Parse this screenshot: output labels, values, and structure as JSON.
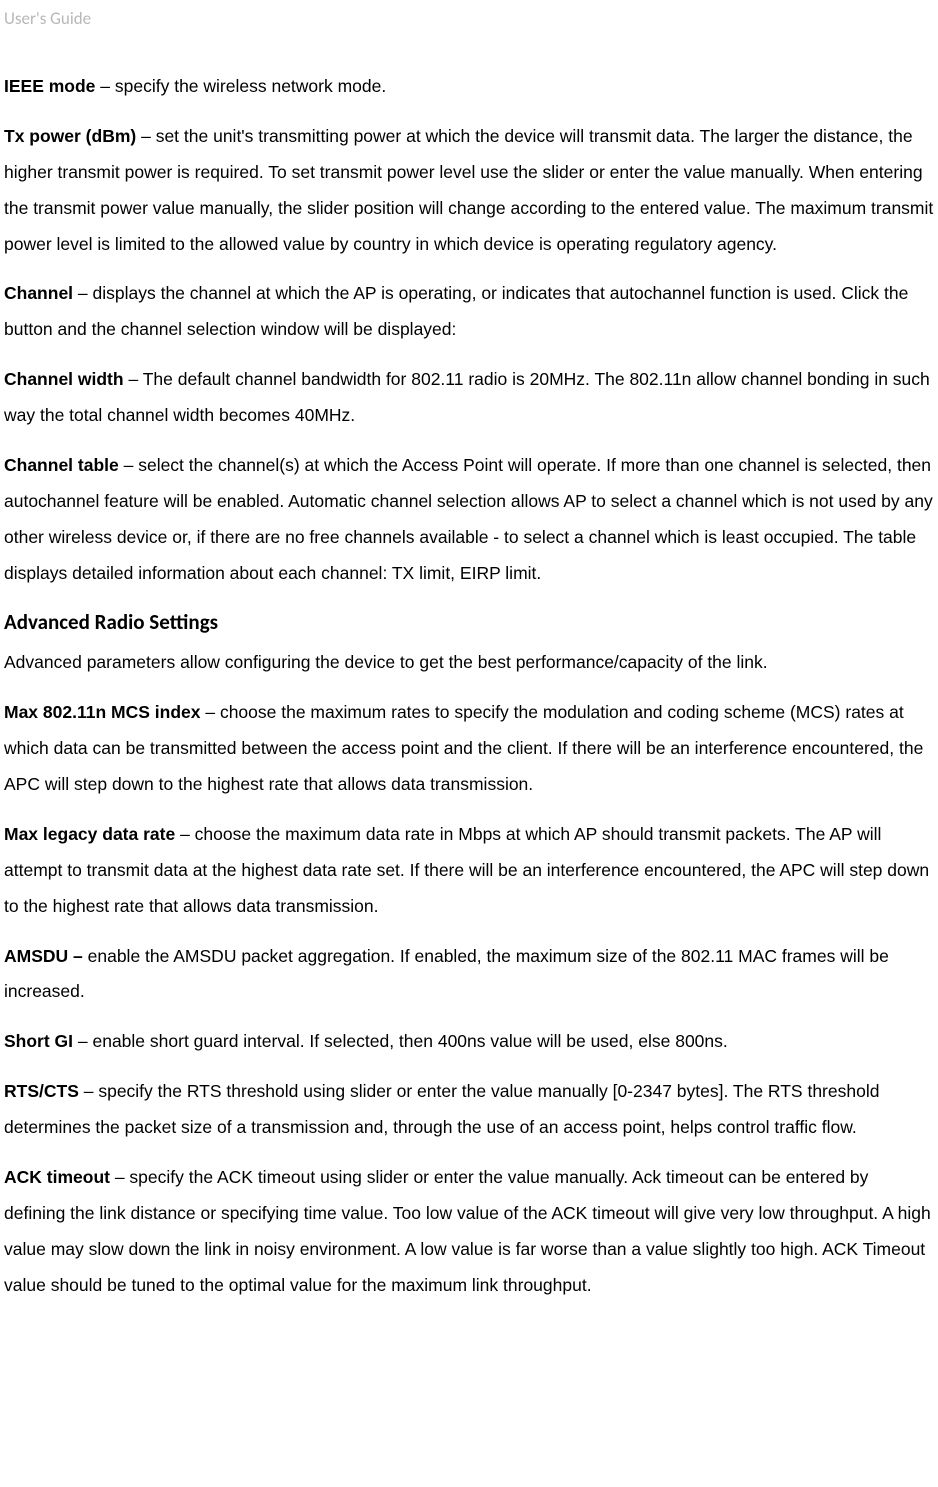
{
  "header": {
    "label": "User's Guide"
  },
  "paragraphs": {
    "ieee_mode": {
      "term": "IEEE mode",
      "text": " – specify the wireless network mode."
    },
    "tx_power": {
      "term": "Tx power (dBm)",
      "text": " – set the unit's transmitting power at which the device will transmit data. The larger the distance, the higher transmit power is required. To set transmit power level use the slider or enter the value manually. When entering the transmit power value manually, the slider position will change according to the entered value. The maximum transmit power level is limited to the allowed value by country in which device is operating regulatory agency."
    },
    "channel": {
      "term": "Channel",
      "text": " – displays the channel at which the AP is operating, or indicates that autochannel function is used. Click the button and the channel selection window will be displayed:"
    },
    "channel_width": {
      "term": "Channel width",
      "text": " – The default channel bandwidth for 802.11 radio is 20MHz. The 802.11n allow channel bonding in such way the total channel width becomes 40MHz."
    },
    "channel_table": {
      "term": "Channel table",
      "text": " – select the channel(s) at which the Access Point will operate. If more than one channel is selected, then autochannel feature will be enabled. Automatic channel selection allows AP to select a channel which is not used by any other wireless device or, if there are no free channels available - to select a channel which is least occupied. The table displays detailed information about each channel: TX limit, EIRP limit."
    },
    "advanced_heading": "Advanced Radio Settings",
    "advanced_intro": "Advanced parameters allow configuring the device to get the best performance/capacity of the link.",
    "max_mcs": {
      "term": "Max 802.11n MCS index",
      "text": " – choose the maximum rates to specify the modulation and coding scheme (MCS) rates at which data can be transmitted between the access point and the client. If there will be an interference encountered, the APC will step down to the highest rate that allows data transmission."
    },
    "max_legacy": {
      "term": "Max legacy data rate",
      "text": " – choose the maximum data rate in Mbps at which AP should transmit packets. The AP will attempt to transmit data at the highest data rate set. If there will be an interference encountered, the APC will step down to the highest rate that allows data transmission."
    },
    "amsdu": {
      "term": "AMSDU –",
      "text": " enable the AMSDU packet aggregation. If enabled, the maximum size of the 802.11 MAC frames will be increased."
    },
    "short_gi": {
      "term": "Short GI",
      "text": " – enable short guard interval. If selected, then 400ns value will be used, else 800ns."
    },
    "rts_cts": {
      "term": "RTS/CTS",
      "text": " – specify the RTS threshold using slider or enter the value manually [0-2347 bytes]. The RTS threshold determines the packet size of a transmission and, through the use of an access point, helps control traffic flow."
    },
    "ack_timeout": {
      "term": "ACK timeout",
      "text": " – specify the ACK timeout using slider or enter the value manually. Ack timeout can be entered by defining the link distance or specifying time value. Too low value of the ACK timeout will give very low throughput. A high value may slow down the link in noisy environment. A low value is far worse than a value slightly too high. ACK Timeout value should be tuned to the optimal value for the maximum link throughput."
    }
  }
}
